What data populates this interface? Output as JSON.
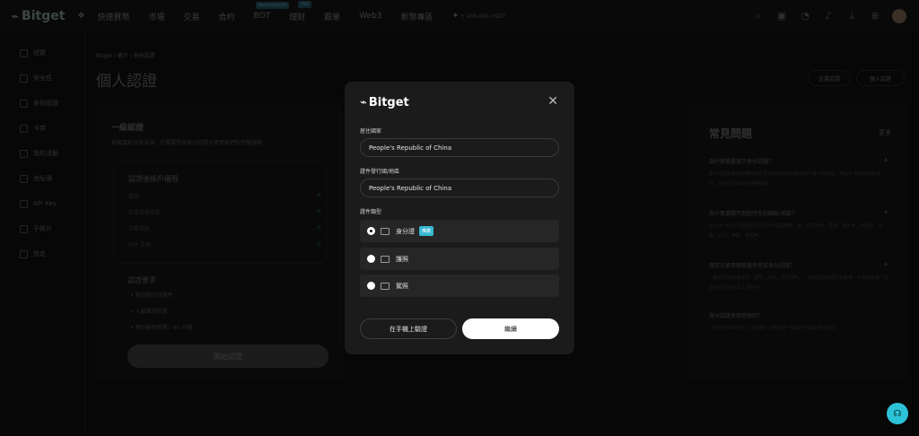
{
  "brand": {
    "logo_mark": "⌁",
    "name": "Bitget"
  },
  "nav": {
    "apps_icon": "grid-icon",
    "items": [
      {
        "label": "快速買幣"
      },
      {
        "label": "市場"
      },
      {
        "label": "交易"
      },
      {
        "label": "合約"
      },
      {
        "label": "BOT",
        "badge": "Recommend"
      },
      {
        "label": "理財",
        "badge": "Hot"
      },
      {
        "label": "跟單"
      },
      {
        "label": "Web3"
      },
      {
        "label": "新幣專區"
      }
    ],
    "asset_text": "+ 400,000 USDT"
  },
  "topbar_icons": [
    "search-icon",
    "wallet-icon",
    "orders-icon",
    "bell-icon",
    "download-icon",
    "globe-icon"
  ],
  "sidebar": {
    "items": [
      {
        "label": "總覽"
      },
      {
        "label": "安全性"
      },
      {
        "label": "身份認證"
      },
      {
        "label": "卡券"
      },
      {
        "label": "我的活動"
      },
      {
        "label": "地址簿"
      },
      {
        "label": "API Key"
      },
      {
        "label": "子帳戶"
      },
      {
        "label": "設定"
      }
    ]
  },
  "breadcrumb": "Bitget / 帳戶 / 身份認證",
  "page_title": "個人認證",
  "top_buttons": {
    "enterprise": "企業認證",
    "personal": "個人認證"
  },
  "card": {
    "title": "一級認證",
    "desc": "根據當地法律法規，您需要完成身分認證以使用我們的完整服務",
    "perm_title": "認證後帳戶權限",
    "perms": [
      "提領",
      "加密貨幣存款",
      "法幣存款",
      "P2P 交易"
    ],
    "req_title": "認證要求",
    "reqs": [
      "政府發行的證件",
      "人臉識別認證",
      "預計審核時間：60 分鐘"
    ],
    "start_button": "開始認證"
  },
  "faq": {
    "title": "常見問題",
    "more": "更多",
    "items": [
      {
        "q": "為什麼需要進行身分認證？",
        "a": "身分認證是金融機構和加密貨幣服務商用來驗證用戶身分的過程。Bitget 會根據您的身分，為您打造最佳的使用體驗。"
      },
      {
        "q": "為什麼選擇不到我所在的國家/地區？",
        "a": "Bitget 不向以下國家/地區的用戶提供服務，如：中國大陸、香港、加拿大、新加坡、北韓、古巴、伊朗、美國等。"
      },
      {
        "q": "我可以使用哪些證件完成身分認證？",
        "a": "一級認證支援身分證、護照、駕照、居住證明。二級認證支援銀行對帳單、水電費帳單（效期均在文件發日 3 個月內）..."
      },
      {
        "q": "身分認證有哪些限制？",
        "a": "1 個自然人帳戶在 1 個主體下只能認證一個帳戶主體的身分認證。"
      }
    ]
  },
  "modal": {
    "logo_mark": "⌁",
    "logo_text": "Bitget",
    "close_icon": "close-icon",
    "country_label": "居住國家",
    "country_value": "People's Republic of China",
    "issuer_label": "證件發行國/地區",
    "issuer_value": "People's Republic of China",
    "doc_type_label": "證件類型",
    "doc_types": [
      {
        "label": "身分證",
        "badge": "推薦",
        "selected": true
      },
      {
        "label": "護照",
        "badge": "",
        "selected": false
      },
      {
        "label": "駕照",
        "badge": "",
        "selected": false
      }
    ],
    "mobile_button": "在手機上驗證",
    "continue_button": "繼續"
  },
  "support_icon": "headset-icon"
}
